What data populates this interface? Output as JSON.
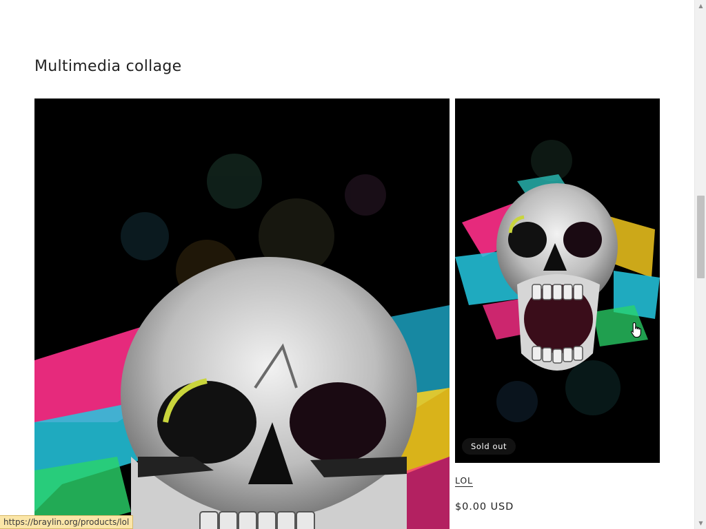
{
  "section": {
    "title": "Multimedia collage"
  },
  "large_media": {
    "alt": "Skull artwork with colorful paint splashes"
  },
  "product_card": {
    "badge": "Sold out",
    "title": "LOL",
    "price": "$0.00 USD"
  },
  "status_bar": {
    "url": "https://braylin.org/products/lol"
  },
  "icons": {
    "scroll_up": "scroll-up-arrow",
    "scroll_down": "scroll-down-arrow",
    "pointer": "hand-pointer-cursor"
  },
  "colors": {
    "background": "#ffffff",
    "text": "#222222",
    "badge_bg": "#121212",
    "status_bar_bg": "#fbe6a8"
  }
}
